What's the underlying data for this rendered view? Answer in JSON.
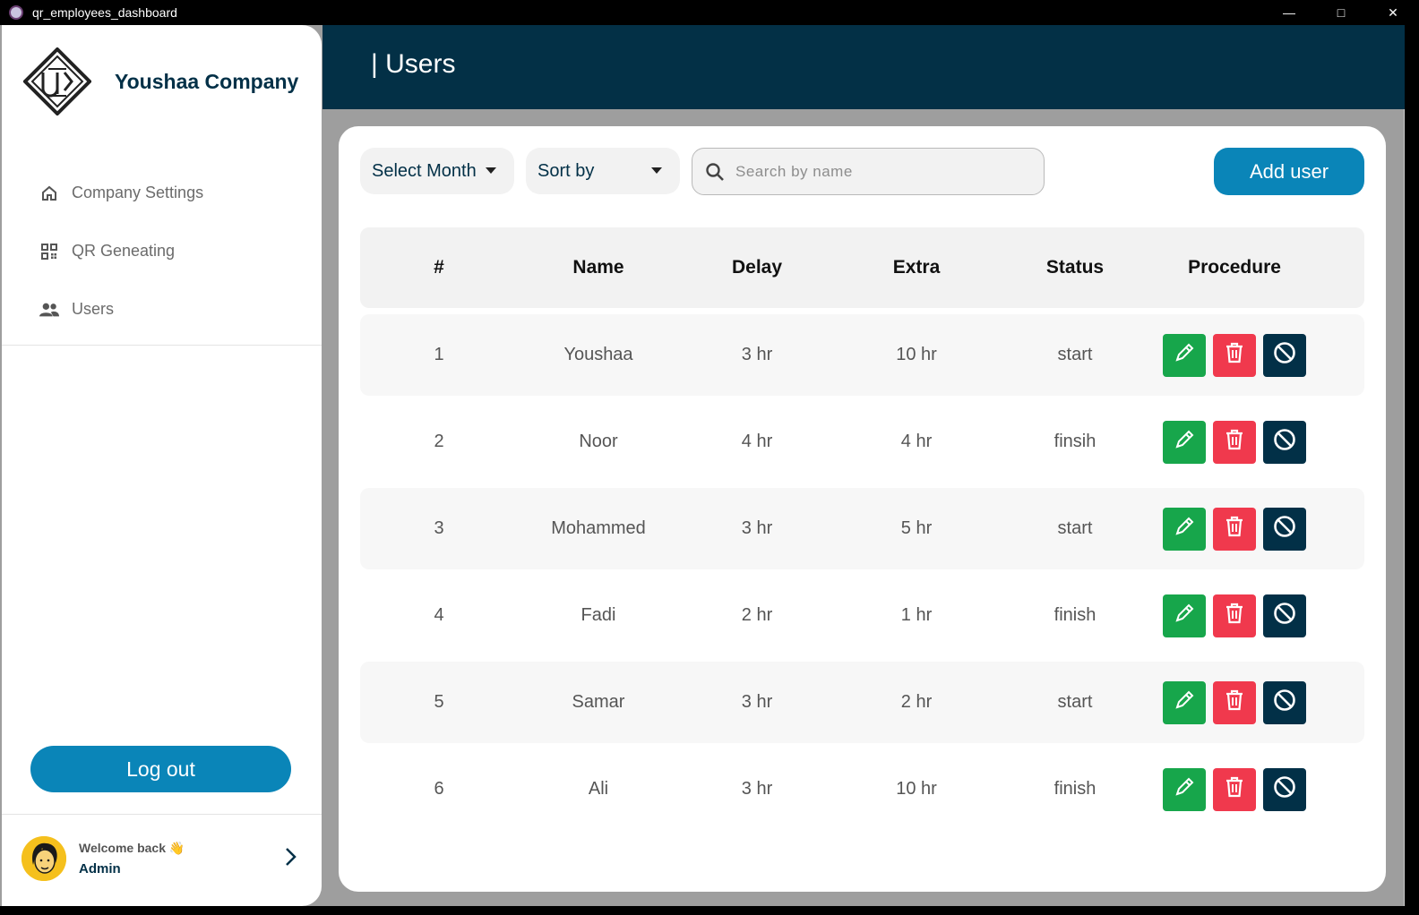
{
  "window": {
    "title": "qr_employees_dashboard"
  },
  "brand": {
    "name": "Youshaa Company"
  },
  "nav": [
    {
      "label": "Company Settings",
      "icon": "home-icon"
    },
    {
      "label": "QR Geneating",
      "icon": "qr-code-icon"
    },
    {
      "label": "Users",
      "icon": "users-icon"
    }
  ],
  "sidebar": {
    "logout_label": "Log out"
  },
  "profile": {
    "welcome": "Welcome back 👋",
    "role": "Admin"
  },
  "header": {
    "title": "| Users"
  },
  "toolbar": {
    "month_label": "Select Month",
    "sort_label": "Sort by",
    "search_placeholder": "Search by name",
    "search_value": "",
    "add_label": "Add user"
  },
  "table": {
    "columns": [
      "#",
      "Name",
      "Delay",
      "Extra",
      "Status",
      "Procedure"
    ],
    "rows": [
      [
        "1",
        "Youshaa",
        "3 hr",
        "10 hr",
        "start"
      ],
      [
        "2",
        "Noor",
        "4 hr",
        "4 hr",
        "finsih"
      ],
      [
        "3",
        "Mohammed",
        "3 hr",
        "5 hr",
        "start"
      ],
      [
        "4",
        "Fadi",
        "2 hr",
        "1 hr",
        "finish"
      ],
      [
        "5",
        "Samar",
        "3 hr",
        "2 hr",
        "start"
      ],
      [
        "6",
        "Ali",
        "3 hr",
        "10 hr",
        "finish"
      ]
    ]
  },
  "colors": {
    "dark": "#023047",
    "accent": "#0a85b8",
    "edit": "#17a64b",
    "delete": "#f0394d",
    "block": "#023047"
  }
}
